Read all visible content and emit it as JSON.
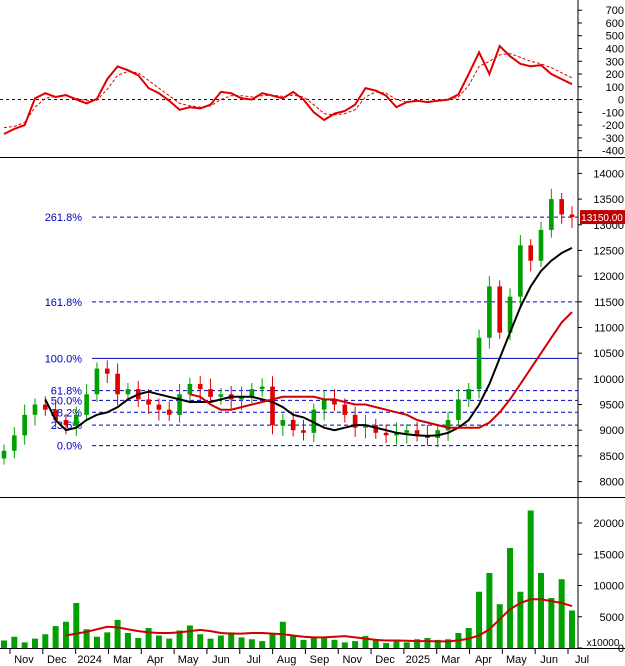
{
  "chart_data": [
    {
      "type": "line",
      "panel": "oscillator",
      "ylim": [
        -450,
        780
      ],
      "yticks": [
        700,
        600,
        500,
        400,
        300,
        200,
        100,
        0,
        -100,
        -200,
        -300,
        -400
      ],
      "zero_line": 0,
      "colors": {
        "line": "#e00000",
        "signal": "#e00000",
        "zero": "#0000a0"
      },
      "series": [
        {
          "style": "solid",
          "values": [
            -270,
            -230,
            -200,
            10,
            50,
            20,
            35,
            0,
            -30,
            5,
            160,
            260,
            230,
            190,
            90,
            50,
            -10,
            -80,
            -60,
            -70,
            -40,
            60,
            50,
            10,
            0,
            50,
            30,
            10,
            60,
            0,
            -100,
            -160,
            -110,
            -90,
            -40,
            90,
            70,
            30,
            -60,
            -20,
            -10,
            -20,
            -10,
            0,
            40,
            200,
            370,
            200,
            420,
            340,
            280,
            260,
            270,
            200,
            160,
            120
          ]
        },
        {
          "style": "dashed",
          "values": [
            -220,
            -210,
            -180,
            -60,
            10,
            25,
            30,
            10,
            -10,
            -5,
            80,
            190,
            220,
            210,
            150,
            90,
            30,
            -30,
            -50,
            -60,
            -50,
            0,
            30,
            30,
            20,
            30,
            35,
            25,
            35,
            20,
            -40,
            -110,
            -120,
            -110,
            -80,
            20,
            60,
            50,
            0,
            -20,
            -15,
            -15,
            -10,
            -5,
            20,
            110,
            260,
            300,
            350,
            360,
            330,
            300,
            280,
            250,
            210,
            170
          ]
        }
      ]
    },
    {
      "type": "candlestick",
      "panel": "price",
      "ylim": [
        7700,
        14300
      ],
      "yticks": [
        14000,
        13500,
        13000,
        12500,
        12000,
        11500,
        11000,
        10500,
        10000,
        9500,
        9000,
        8500,
        8000
      ],
      "last_price_label": "13150.00",
      "colors": {
        "up": "#00a000",
        "down": "#e00000",
        "ma_short": "#000000",
        "ma_long": "#d00000",
        "fib": "#0000c0",
        "price_tag": "#c00000"
      },
      "fibonacci": [
        {
          "label": "261.8%",
          "value": 13150
        },
        {
          "label": "161.8%",
          "value": 11500
        },
        {
          "label": "100.0%",
          "value": 10400
        },
        {
          "label": "61.8%",
          "value": 9770
        },
        {
          "label": "50.0%",
          "value": 9580
        },
        {
          "label": "38.2%",
          "value": 9350
        },
        {
          "label": "23.6%",
          "value": 9100
        },
        {
          "label": "0.0%",
          "value": 8700
        }
      ],
      "closes": [
        8600,
        8900,
        9300,
        9500,
        9400,
        9200,
        9100,
        9300,
        9700,
        10200,
        10100,
        9700,
        9800,
        9600,
        9500,
        9400,
        9300,
        9700,
        9900,
        9800,
        9650,
        9700,
        9600,
        9650,
        9800,
        9850,
        9100,
        9200,
        9000,
        8950,
        9400,
        9600,
        9500,
        9300,
        9050,
        9100,
        8950,
        8900,
        8950,
        9000,
        8900,
        8850,
        9000,
        9200,
        9600,
        9800,
        10800,
        11800,
        10900,
        11600,
        12600,
        12300,
        12900,
        13500,
        13200,
        13150
      ],
      "ma_short": [
        9600,
        9200,
        9000,
        9050,
        9200,
        9300,
        9350,
        9450,
        9600,
        9700,
        9750,
        9700,
        9650,
        9600,
        9550,
        9550,
        9550,
        9600,
        9650,
        9650,
        9650,
        9600,
        9550,
        9450,
        9300,
        9250,
        9150,
        9050,
        9000,
        9050,
        9100,
        9100,
        9050,
        9000,
        8950,
        8920,
        8900,
        8890,
        8900,
        8950,
        9050,
        9200,
        9500,
        9900,
        10400,
        10900,
        11400,
        11800,
        12100,
        12300,
        12450,
        12550
      ],
      "ma_long": [
        9700,
        9650,
        9500,
        9400,
        9400,
        9450,
        9500,
        9550,
        9600,
        9650,
        9650,
        9650,
        9650,
        9600,
        9600,
        9550,
        9500,
        9500,
        9450,
        9400,
        9350,
        9300,
        9200,
        9150,
        9100,
        9050,
        9050,
        9050,
        9050,
        9150,
        9350,
        9600,
        9900,
        10200,
        10500,
        10800,
        11100,
        11300
      ]
    },
    {
      "type": "bar",
      "panel": "volume",
      "ylim": [
        0,
        24000
      ],
      "yticks": [
        20000,
        15000,
        10000,
        5000,
        0
      ],
      "unit_label": "x10000",
      "colors": {
        "bar": "#00a000",
        "ma": "#d00000"
      },
      "values": [
        1200,
        1800,
        900,
        1500,
        2200,
        3500,
        4200,
        7200,
        3000,
        1800,
        2500,
        4500,
        2400,
        1600,
        3200,
        2000,
        1500,
        2800,
        3600,
        2200,
        1500,
        2000,
        2500,
        1700,
        1400,
        1100,
        2400,
        4200,
        1900,
        1300,
        1700,
        1600,
        1300,
        900,
        1100,
        1900,
        1300,
        800,
        1200,
        900,
        1400,
        1600,
        1300,
        1400,
        2400,
        3200,
        9000,
        12000,
        7000,
        16000,
        9000,
        22000,
        12000,
        8000,
        11000,
        6000
      ],
      "ma": [
        2000,
        2300,
        2600,
        3000,
        3400,
        3300,
        3000,
        2700,
        2500,
        2400,
        2400,
        2500,
        2700,
        2900,
        2700,
        2400,
        2300,
        2300,
        2400,
        2400,
        2300,
        2200,
        2000,
        1800,
        1700,
        1700,
        1800,
        1900,
        1700,
        1500,
        1300,
        1200,
        1200,
        1150,
        1100,
        1100,
        1050,
        1050,
        1200,
        1500,
        2000,
        3000,
        4600,
        6200,
        7200,
        7800,
        7800,
        7500,
        7200,
        6700
      ]
    }
  ],
  "x_axis": {
    "months": [
      "Nov",
      "Dec",
      "2024",
      "Mar",
      "Apr",
      "May",
      "Jun",
      "Jul",
      "Aug",
      "Sep",
      "Nov",
      "Dec",
      "2025",
      "Mar",
      "Apr",
      "May",
      "Jun",
      "Jul"
    ]
  }
}
